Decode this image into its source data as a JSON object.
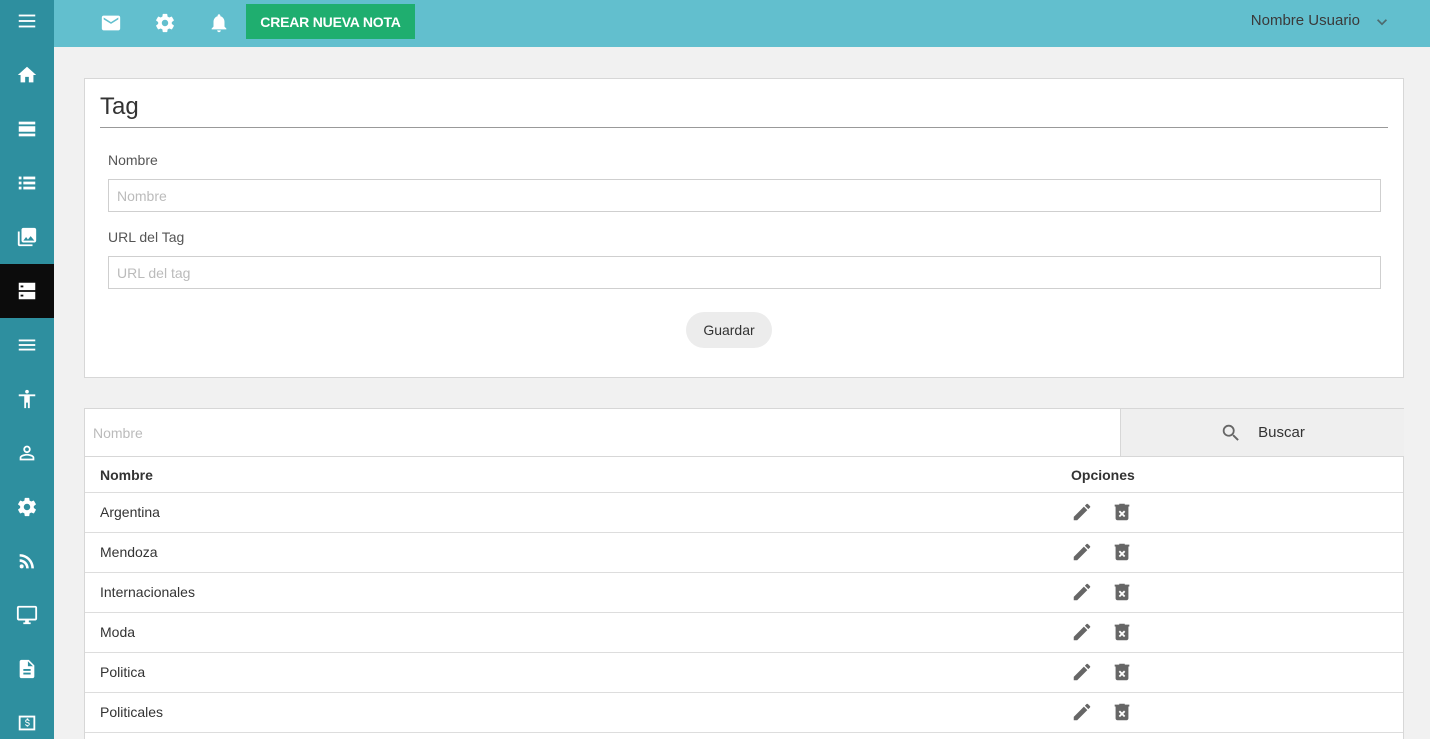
{
  "sidebar": {
    "items": [
      {
        "icon": "menu-icon"
      },
      {
        "icon": "home-icon"
      },
      {
        "icon": "notes-icon"
      },
      {
        "icon": "list-icon"
      },
      {
        "icon": "gallery-icon"
      },
      {
        "icon": "tags-icon",
        "active": true
      },
      {
        "icon": "lines-icon"
      },
      {
        "icon": "accessibility-icon"
      },
      {
        "icon": "user-icon"
      },
      {
        "icon": "settings-icon"
      },
      {
        "icon": "rss-icon"
      },
      {
        "icon": "monitor-icon"
      },
      {
        "icon": "document-icon"
      },
      {
        "icon": "money-icon"
      }
    ]
  },
  "topbar": {
    "icons": [
      "mail-icon",
      "gear-icon",
      "bell-icon"
    ],
    "new_note_label": "CREAR NUEVA NOTA",
    "user_name": "Nombre Usuario"
  },
  "form": {
    "title": "Tag",
    "name_label": "Nombre",
    "name_placeholder": "Nombre",
    "url_label": "URL del Tag",
    "url_placeholder": "URL del tag",
    "save_label": "Guardar"
  },
  "table": {
    "search_placeholder": "Nombre",
    "search_label": "Buscar",
    "columns": [
      "Nombre",
      "Opciones"
    ],
    "rows": [
      "Argentina",
      "Mendoza",
      "Internacionales",
      "Moda",
      "Politica",
      "Politicales"
    ]
  },
  "colors": {
    "sidebar": "#2e8f9f",
    "topbar": "#62bfce",
    "accent_green": "#1fae6f",
    "active_item": "#0c0c0c"
  }
}
